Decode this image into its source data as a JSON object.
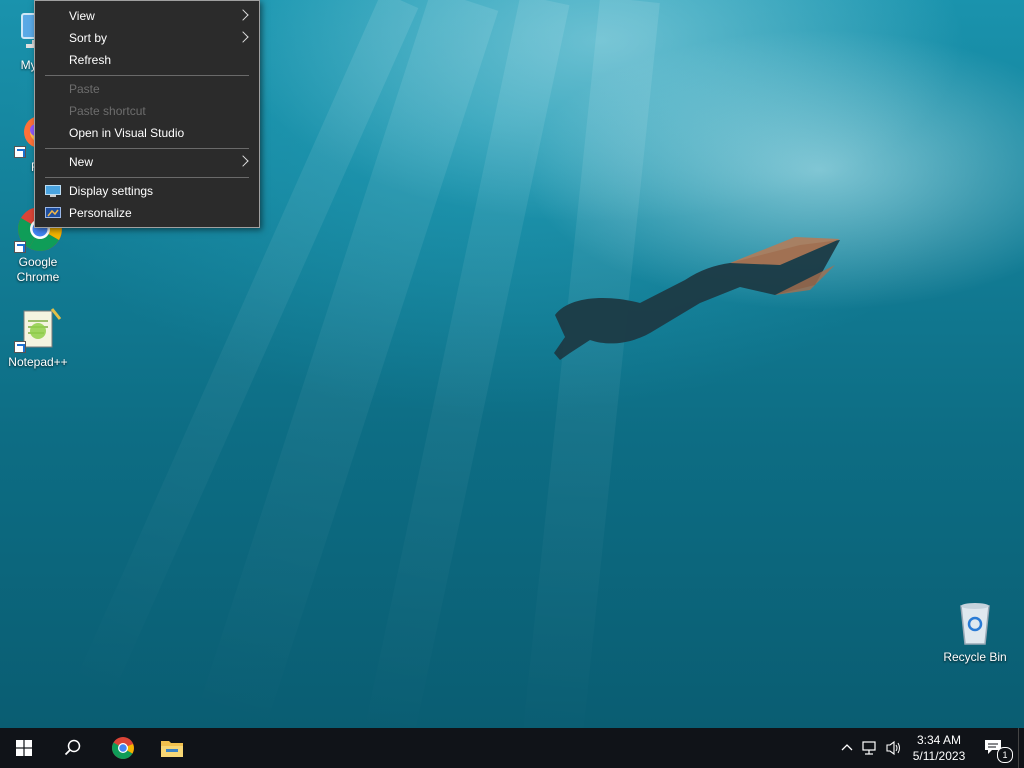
{
  "desktop": {
    "icons": [
      {
        "label": "My Co",
        "name": "my-computer"
      },
      {
        "label": "Fir",
        "name": "firefox"
      },
      {
        "label": "Google Chrome",
        "name": "google-chrome"
      },
      {
        "label": "Notepad++",
        "name": "notepad-plus-plus"
      },
      {
        "label": "Recycle Bin",
        "name": "recycle-bin"
      }
    ]
  },
  "context_menu": {
    "items": [
      {
        "label": "View",
        "enabled": true,
        "submenu": true
      },
      {
        "label": "Sort by",
        "enabled": true,
        "submenu": true
      },
      {
        "label": "Refresh",
        "enabled": true,
        "submenu": false
      },
      {
        "label": "Paste",
        "enabled": false,
        "submenu": false
      },
      {
        "label": "Paste shortcut",
        "enabled": false,
        "submenu": false
      },
      {
        "label": "Open in Visual Studio",
        "enabled": true,
        "submenu": false
      },
      {
        "label": "New",
        "enabled": true,
        "submenu": true
      },
      {
        "label": "Display settings",
        "enabled": true,
        "submenu": false,
        "icon": "display-icon"
      },
      {
        "label": "Personalize",
        "enabled": true,
        "submenu": false,
        "icon": "personalize-icon"
      }
    ]
  },
  "taskbar": {
    "clock_time": "3:34 AM",
    "clock_date": "5/11/2023",
    "notification_count": "1",
    "pinned": [
      "start-icon",
      "search-icon",
      "chrome-icon",
      "file-explorer-icon"
    ]
  },
  "colors": {
    "menu_bg": "#2b2b2b",
    "taskbar_bg": "#101318",
    "disabled_text": "#6d6d6d"
  }
}
